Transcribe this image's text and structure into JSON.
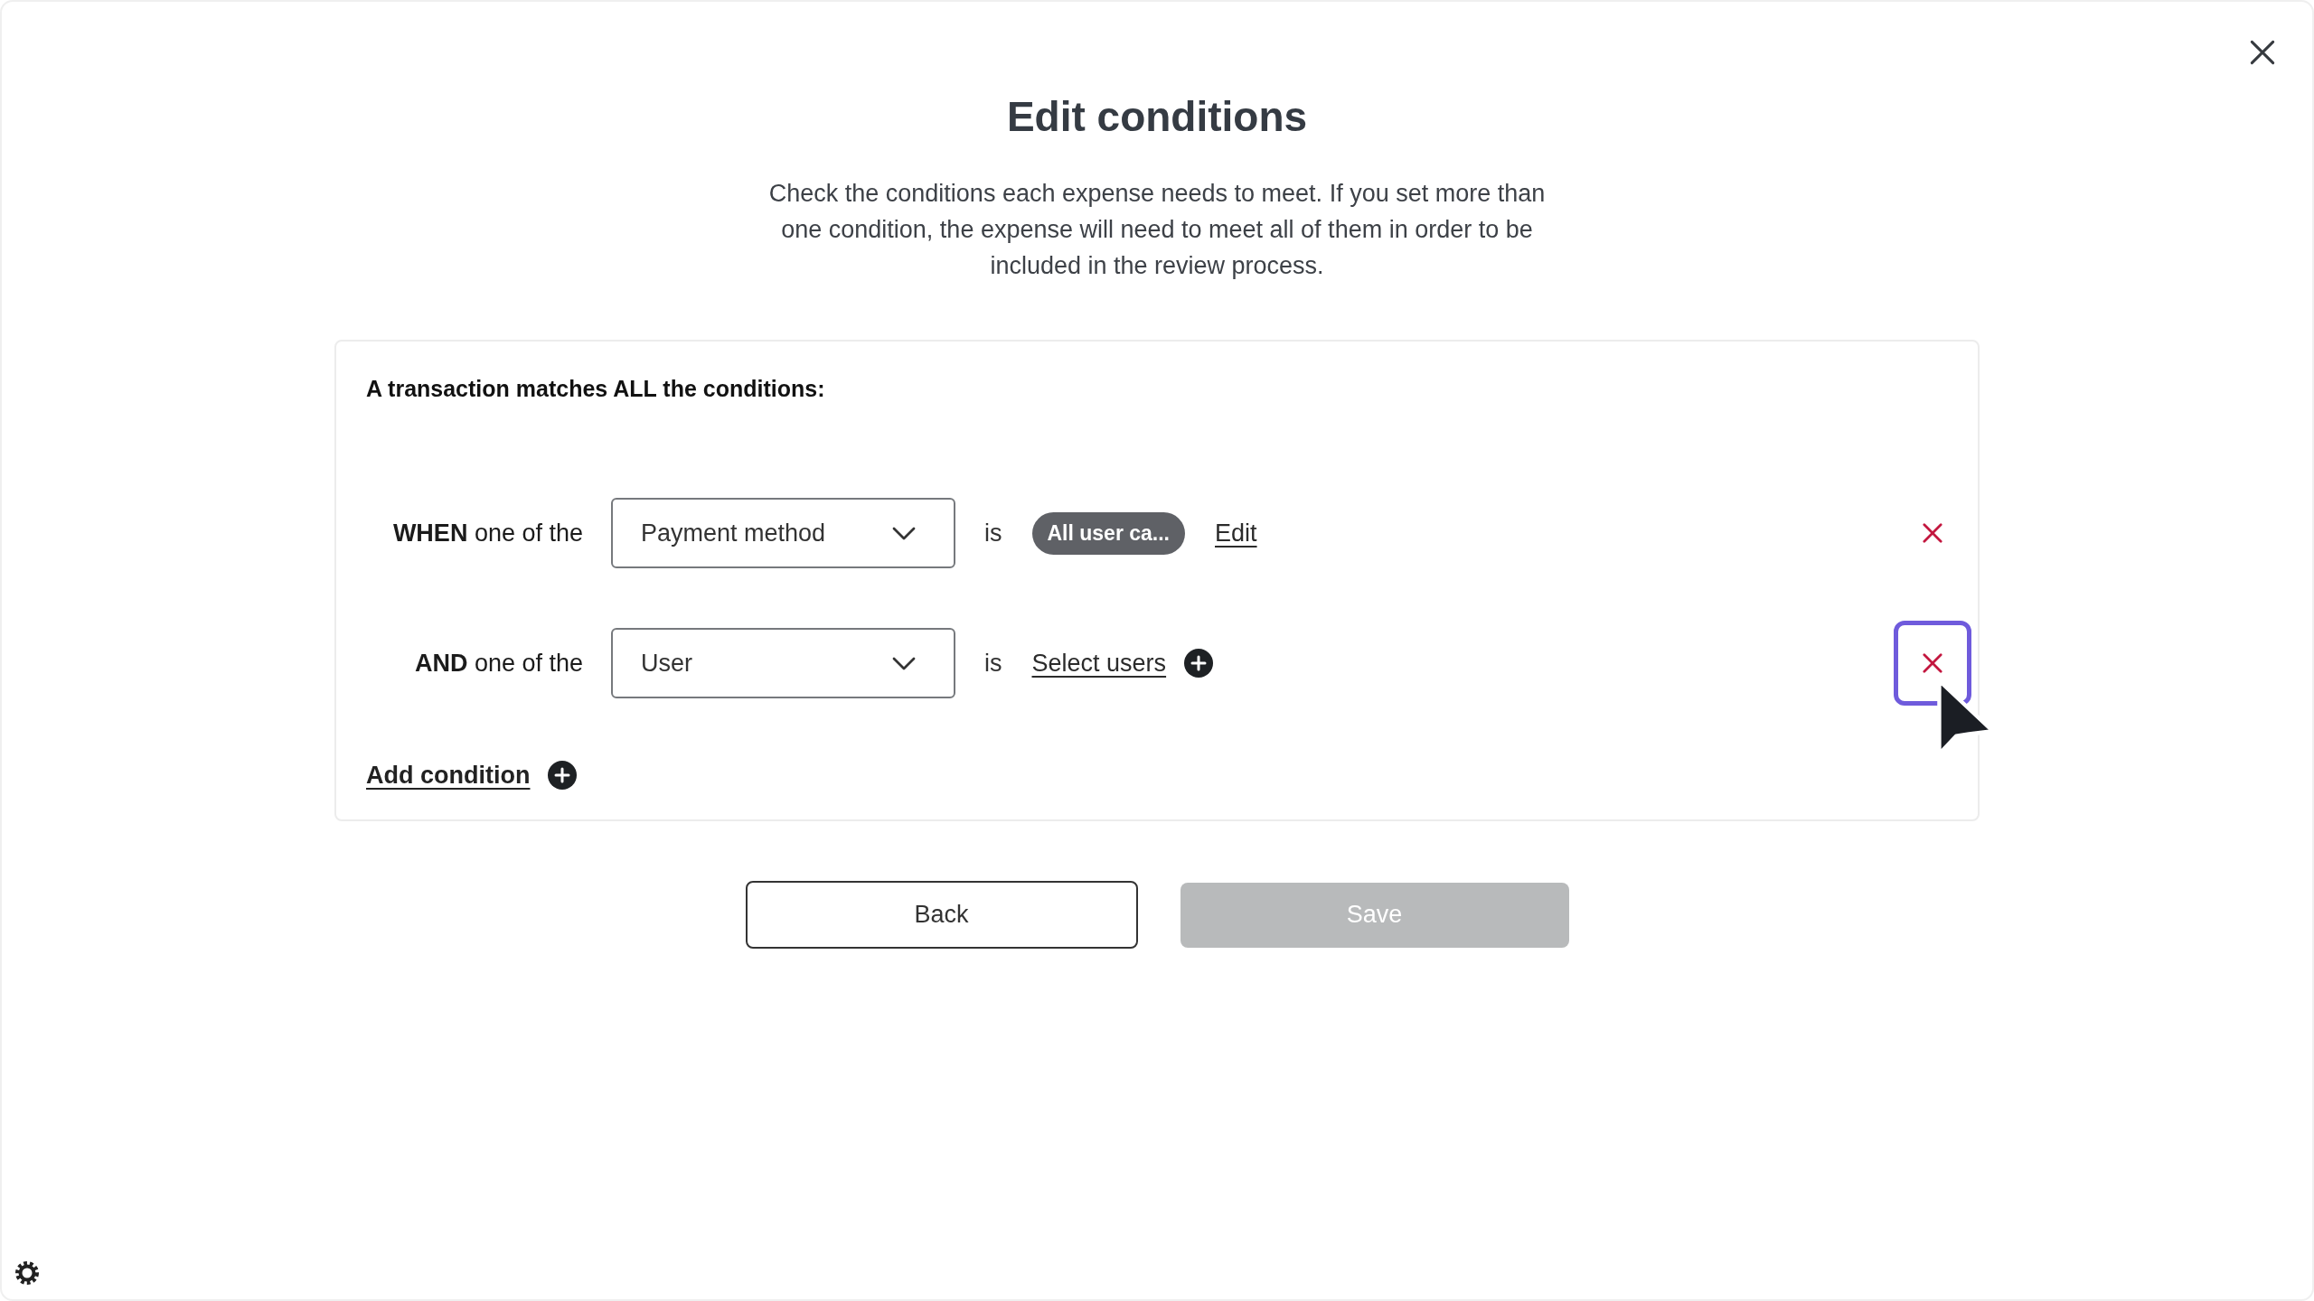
{
  "dialog": {
    "title": "Edit conditions",
    "description": "Check the conditions each expense needs to meet. If you set more than one condition, the expense will need to meet all of them in order to be included in the review process."
  },
  "card": {
    "heading": "A transaction matches ALL the conditions:",
    "conditions": [
      {
        "kind": "chip",
        "label": "**WHEN** one of the",
        "field": "Payment method",
        "operator": "is",
        "value": "All user ca...",
        "action": "Edit",
        "focused": false
      },
      {
        "kind": "picker",
        "label": "**AND** one of the",
        "field": "User",
        "operator": "is",
        "value": "Select users",
        "focused": true
      }
    ],
    "add_condition": "Add condition"
  },
  "buttons": [
    {
      "label": "Back",
      "kind": "secondary",
      "disabled": false
    },
    {
      "label": "Save",
      "kind": "primary",
      "disabled": true
    }
  ]
}
